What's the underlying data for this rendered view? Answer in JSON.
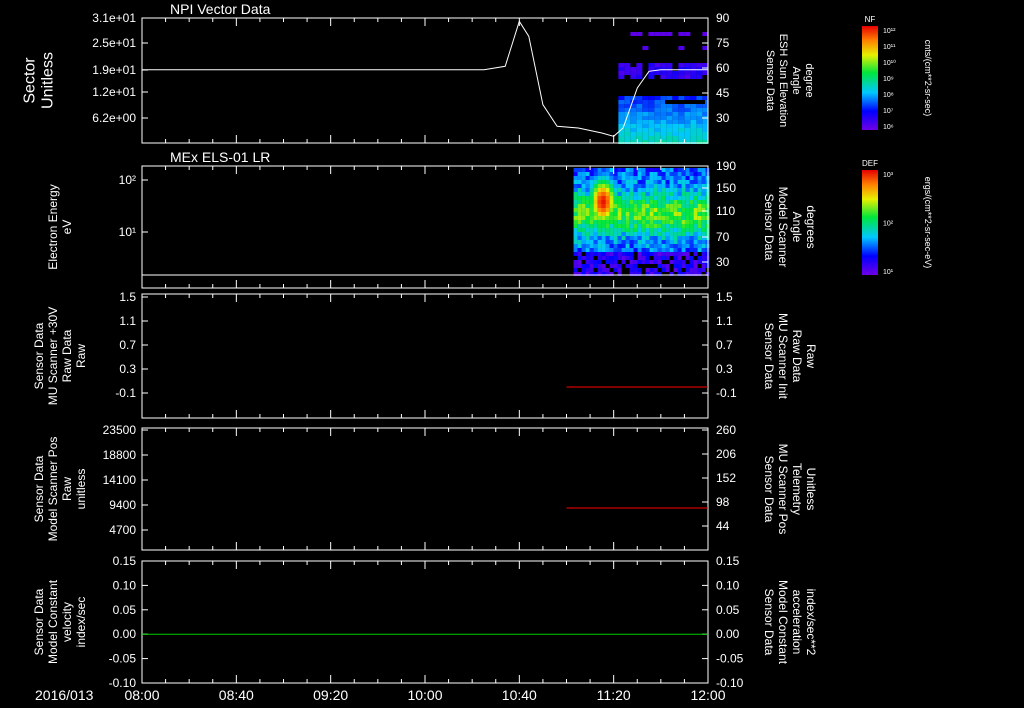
{
  "chart_data": [
    {
      "type": "line",
      "title": "NPI Vector Data",
      "ylabel_left": [
        "Sector",
        "Unitless"
      ],
      "ylabel_right": [
        "Sensor Data",
        "ESH Sun Elevation",
        "Angle",
        "degree"
      ],
      "left_ticks": [
        "3.1e+01",
        "2.5e+01",
        "1.9e+01",
        "1.2e+01",
        "6.2e+00"
      ],
      "right_ticks": [
        "90",
        "75",
        "60",
        "45",
        "30"
      ],
      "right_ylim": [
        15,
        90
      ],
      "series": [
        {
          "x": [
            "08:00",
            "09:00",
            "10:00",
            "10:25",
            "10:34",
            "10:40",
            "10:44",
            "10:50",
            "10:56",
            "11:05",
            "11:15",
            "11:20",
            "11:24",
            "11:30",
            "11:35",
            "11:40",
            "12:00"
          ],
          "y": [
            59,
            59,
            59,
            59,
            61,
            88,
            79,
            38,
            25,
            24,
            21,
            19,
            24,
            48,
            58,
            59,
            59
          ],
          "color": "#ffffff"
        }
      ],
      "spectrogram": {
        "time_range": [
          "11:22",
          "12:00"
        ],
        "colorbar_label": "NF",
        "colorbar_units": "cnts/(cm**2-sr-sec)",
        "colorbar_ticks": [
          "10^12",
          "10^11",
          "10^10",
          "10^9",
          "10^8",
          "10^7",
          "10^6"
        ]
      }
    },
    {
      "type": "heatmap",
      "title": "MEx ELS-01 LR",
      "ylabel_left": [
        "Electron Energy",
        "eV"
      ],
      "ylabel_right": [
        "Sensor Data",
        "Model Scanner",
        "Angle",
        "degrees"
      ],
      "left_ticks": [
        "10^2",
        "10^1"
      ],
      "right_ticks": [
        "190",
        "150",
        "110",
        "70",
        "30"
      ],
      "right_ylim": [
        0,
        190
      ],
      "series": [
        {
          "x": [
            "08:00",
            "12:00"
          ],
          "y": [
            10,
            10
          ],
          "color": "#ffffff"
        }
      ],
      "spectrogram": {
        "time_range": [
          "11:03",
          "12:00"
        ],
        "colorbar_label": "DEF",
        "colorbar_units": "ergs/(cm**2-sr-sec-eV)",
        "colorbar_ticks": [
          "10^3",
          "10^2",
          "10^1"
        ]
      }
    },
    {
      "type": "line",
      "ylabel_left": [
        "Sensor Data",
        "MU Scanner +30V",
        "Raw Data",
        "Raw"
      ],
      "ylabel_right": [
        "Sensor Data",
        "MU Scanner Init",
        "Raw Data",
        "Raw"
      ],
      "left_ticks": [
        "1.5",
        "1.1",
        "0.7",
        "0.3",
        "-0.1"
      ],
      "right_ticks": [
        "1.5",
        "1.1",
        "0.7",
        "0.3",
        "-0.1"
      ],
      "ylim": [
        -0.35,
        1.5
      ],
      "series": [
        {
          "x": [
            "11:00",
            "12:00"
          ],
          "y": [
            0.0,
            0.0
          ],
          "color": "#ff0000"
        }
      ]
    },
    {
      "type": "line",
      "ylabel_left": [
        "Sensor Data",
        "Model Scanner Pos",
        "Raw",
        "unitless"
      ],
      "ylabel_right": [
        "Sensor Data",
        "MU Scanner Pos",
        "Telemetry",
        "Unitless"
      ],
      "left_ticks": [
        "23500",
        "18800",
        "14100",
        "9400",
        "4700"
      ],
      "right_ticks": [
        "260",
        "206",
        "152",
        "98",
        "44"
      ],
      "ylim": [
        0,
        23500
      ],
      "series": [
        {
          "x": [
            "11:00",
            "12:00"
          ],
          "y": [
            8000,
            8000
          ],
          "color": "#ff0000"
        }
      ]
    },
    {
      "type": "line",
      "ylabel_left": [
        "Sensor Data",
        "Model Constant",
        "velocity",
        "index/sec"
      ],
      "ylabel_right": [
        "Sensor Data",
        "Model Constant",
        "acceleration",
        "index/sec**2"
      ],
      "left_ticks": [
        "0.15",
        "0.10",
        "0.05",
        "0.00",
        "-0.05",
        "-0.10"
      ],
      "right_ticks": [
        "0.15",
        "0.10",
        "0.05",
        "0.00",
        "-0.05",
        "-0.10"
      ],
      "ylim": [
        -0.1,
        0.15
      ],
      "series": [
        {
          "x": [
            "08:00",
            "12:00"
          ],
          "y": [
            0.0,
            0.0
          ],
          "color": "#00cc00"
        }
      ]
    }
  ],
  "x_axis": {
    "date": "2016/013",
    "ticks": [
      "08:00",
      "08:40",
      "09:20",
      "10:00",
      "10:40",
      "11:20",
      "12:00"
    ],
    "range": [
      "08:00",
      "12:00"
    ]
  },
  "colors": {
    "right_label_panel3": "#ff0000",
    "right_label_panel4": "#ff0000",
    "right_label_panel5": "#00ff00"
  }
}
